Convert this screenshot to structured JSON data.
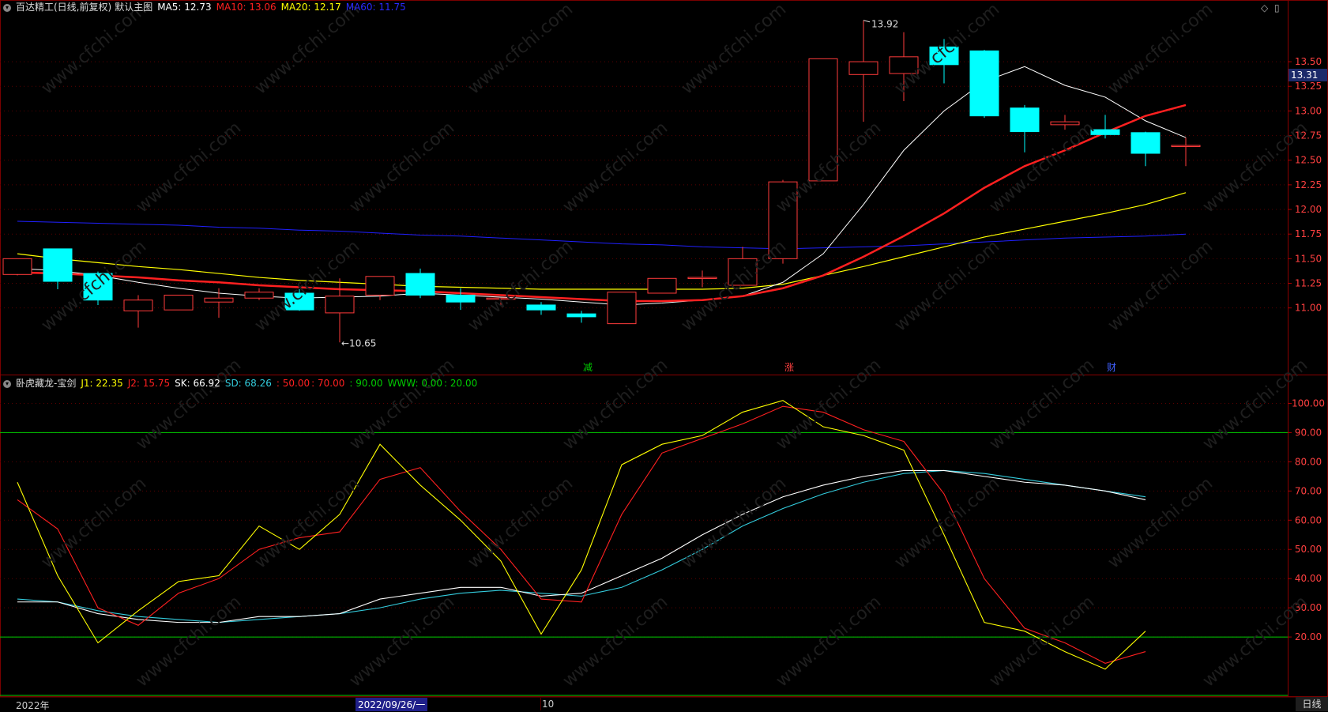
{
  "main_header": {
    "title": "百达精工(日线,前复权)",
    "main_chart": "默认主图",
    "ma5": "MA5: 12.73",
    "ma10": "MA10: 13.06",
    "ma20": "MA20: 12.17",
    "ma60": "MA60: 11.75"
  },
  "sub_header": {
    "title": "卧虎藏龙-宝剑",
    "j1": "J1: 22.35",
    "j2": "J2: 15.75",
    "sk": "SK: 66.92",
    "sd": "SD: 68.26",
    "c1": ": 50.00",
    "c2": ": 70.00",
    "c3": ": 90.00",
    "www": "WWW: 0.00",
    "c4": ": 20.00"
  },
  "current_price_tag": "13.31",
  "bottom_bar": {
    "date_start": "2022年",
    "date_cursor": "2022/09/26/一",
    "date_month": "10",
    "period_tab": "日线"
  },
  "colors": {
    "up": "#ff3b3b",
    "down": "#00ffff",
    "ma5": "#ffffff",
    "ma10": "#ff2020",
    "ma20": "#ffff00",
    "ma60": "#2020ff",
    "j1": "#ffff00",
    "j2": "#ff2020",
    "sk": "#ffffff",
    "sd": "#33ccdd",
    "hline": "#00cc00"
  },
  "chart_data": [
    {
      "type": "candlestick",
      "y_axis_ticks": [
        "11.00",
        "11.25",
        "11.50",
        "11.75",
        "12.00",
        "12.25",
        "12.50",
        "12.75",
        "13.00",
        "13.25",
        "13.50"
      ],
      "ylim": [
        10.5,
        13.95
      ],
      "candles": [
        {
          "o": 11.34,
          "h": 11.5,
          "l": 11.33,
          "c": 11.5
        },
        {
          "o": 11.6,
          "h": 11.6,
          "l": 11.19,
          "c": 11.27
        },
        {
          "o": 11.35,
          "h": 11.37,
          "l": 11.03,
          "c": 11.08
        },
        {
          "o": 10.97,
          "h": 11.13,
          "l": 10.8,
          "c": 11.08
        },
        {
          "o": 10.98,
          "h": 11.13,
          "l": 10.98,
          "c": 11.13
        },
        {
          "o": 11.06,
          "h": 11.2,
          "l": 10.9,
          "c": 11.1
        },
        {
          "o": 11.1,
          "h": 11.2,
          "l": 11.08,
          "c": 11.16
        },
        {
          "o": 11.15,
          "h": 11.19,
          "l": 10.97,
          "c": 10.98
        },
        {
          "o": 10.95,
          "h": 11.3,
          "l": 10.65,
          "c": 11.12
        },
        {
          "o": 11.13,
          "h": 11.32,
          "l": 11.08,
          "c": 11.32
        },
        {
          "o": 11.35,
          "h": 11.4,
          "l": 11.1,
          "c": 11.13
        },
        {
          "o": 11.13,
          "h": 11.2,
          "l": 10.98,
          "c": 11.06
        },
        {
          "o": 11.1,
          "h": 11.1,
          "l": 11.02,
          "c": 11.1
        },
        {
          "o": 11.03,
          "h": 11.06,
          "l": 10.93,
          "c": 10.98
        },
        {
          "o": 10.94,
          "h": 10.97,
          "l": 10.85,
          "c": 10.91
        },
        {
          "o": 10.84,
          "h": 11.16,
          "l": 10.84,
          "c": 11.16
        },
        {
          "o": 11.15,
          "h": 11.3,
          "l": 11.15,
          "c": 11.3
        },
        {
          "o": 11.31,
          "h": 11.38,
          "l": 11.21,
          "c": 11.31
        },
        {
          "o": 11.23,
          "h": 11.62,
          "l": 11.23,
          "c": 11.5
        },
        {
          "o": 11.5,
          "h": 12.3,
          "l": 11.45,
          "c": 12.28
        },
        {
          "o": 12.29,
          "h": 13.53,
          "l": 12.29,
          "c": 13.53
        },
        {
          "o": 13.37,
          "h": 13.92,
          "l": 12.89,
          "c": 13.5
        },
        {
          "o": 13.38,
          "h": 13.8,
          "l": 13.1,
          "c": 13.55
        },
        {
          "o": 13.65,
          "h": 13.73,
          "l": 13.28,
          "c": 13.47
        },
        {
          "o": 13.61,
          "h": 13.62,
          "l": 12.93,
          "c": 12.95
        },
        {
          "o": 13.03,
          "h": 13.06,
          "l": 12.58,
          "c": 12.79
        },
        {
          "o": 12.86,
          "h": 12.96,
          "l": 12.81,
          "c": 12.89
        },
        {
          "o": 12.81,
          "h": 12.96,
          "l": 12.72,
          "c": 12.76
        },
        {
          "o": 12.78,
          "h": 12.79,
          "l": 12.44,
          "c": 12.57
        },
        {
          "o": 12.65,
          "h": 12.73,
          "l": 12.44,
          "c": 12.65
        }
      ],
      "ma5": [
        11.4,
        11.38,
        11.33,
        11.26,
        11.2,
        11.15,
        11.12,
        11.1,
        11.11,
        11.12,
        11.15,
        11.13,
        11.11,
        11.09,
        11.06,
        11.03,
        11.05,
        11.08,
        11.12,
        11.26,
        11.55,
        12.05,
        12.6,
        13.0,
        13.3,
        13.45,
        13.26,
        13.14,
        12.9,
        12.73
      ],
      "ma10": [
        11.36,
        11.35,
        11.33,
        11.31,
        11.28,
        11.26,
        11.23,
        11.21,
        11.19,
        11.18,
        11.17,
        11.15,
        11.13,
        11.11,
        11.09,
        11.07,
        11.07,
        11.08,
        11.12,
        11.2,
        11.33,
        11.52,
        11.73,
        11.96,
        12.22,
        12.44,
        12.6,
        12.78,
        12.95,
        13.06
      ],
      "ma20": [
        11.55,
        11.5,
        11.46,
        11.42,
        11.39,
        11.35,
        11.31,
        11.28,
        11.26,
        11.24,
        11.22,
        11.21,
        11.2,
        11.19,
        11.19,
        11.19,
        11.19,
        11.19,
        11.2,
        11.24,
        11.33,
        11.42,
        11.52,
        11.62,
        11.72,
        11.8,
        11.88,
        11.96,
        12.05,
        12.17
      ],
      "ma60": [
        11.88,
        11.87,
        11.86,
        11.85,
        11.84,
        11.82,
        11.81,
        11.79,
        11.78,
        11.76,
        11.74,
        11.73,
        11.71,
        11.69,
        11.67,
        11.65,
        11.64,
        11.62,
        11.61,
        11.6,
        11.61,
        11.62,
        11.63,
        11.65,
        11.67,
        11.69,
        11.71,
        11.72,
        11.73,
        11.75
      ],
      "annotations": [
        {
          "text": "13.92",
          "index": 21,
          "value": 13.92
        },
        {
          "text": "10.65",
          "index": 8,
          "value": 10.65
        }
      ],
      "markers": [
        {
          "text": "减",
          "index": 14
        },
        {
          "text": "涨",
          "index": 19
        },
        {
          "text": "财",
          "index": 27
        }
      ]
    },
    {
      "type": "line",
      "y_axis_ticks": [
        "20.00",
        "30.00",
        "40.00",
        "50.00",
        "60.00",
        "70.00",
        "80.00",
        "90.00",
        "100.00"
      ],
      "ylim": [
        0,
        105
      ],
      "series": [
        {
          "name": "J1",
          "values": [
            73,
            41,
            18,
            29,
            39,
            41,
            58,
            50,
            62,
            86,
            72,
            60,
            46,
            21,
            43,
            79,
            86,
            89,
            97,
            101,
            92,
            89,
            84,
            55,
            25,
            22,
            15,
            9,
            22
          ]
        },
        {
          "name": "J2",
          "values": [
            67,
            57,
            30,
            24,
            35,
            40,
            50,
            54,
            56,
            74,
            78,
            63,
            50,
            33,
            32,
            62,
            83,
            88,
            93,
            99,
            97,
            91,
            87,
            69,
            40,
            23,
            18,
            11,
            15
          ]
        },
        {
          "name": "SK",
          "values": [
            32,
            32,
            28,
            26,
            25,
            25,
            27,
            27,
            28,
            33,
            35,
            37,
            37,
            34,
            35,
            41,
            47,
            55,
            62,
            68,
            72,
            75,
            77,
            77,
            75,
            73,
            72,
            70,
            67
          ]
        },
        {
          "name": "SD",
          "values": [
            33,
            32,
            29,
            27,
            26,
            25,
            26,
            27,
            28,
            30,
            33,
            35,
            36,
            35,
            34,
            37,
            43,
            50,
            58,
            64,
            69,
            73,
            76,
            77,
            76,
            74,
            72,
            70,
            68
          ]
        }
      ],
      "hlines": [
        90,
        20,
        0
      ]
    }
  ]
}
